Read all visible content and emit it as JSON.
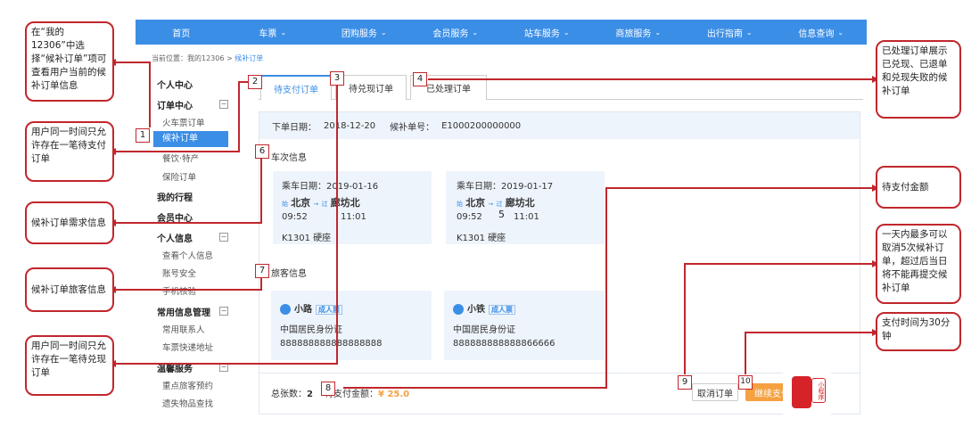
{
  "nav": [
    "首页",
    "车票",
    "团购服务",
    "会员服务",
    "站车服务",
    "商旅服务",
    "出行指南",
    "信息查询"
  ],
  "breadcrumb": {
    "prefix": "当前位置：",
    "path": "我的12306 > ",
    "current": "候补订单"
  },
  "sidebar": {
    "personal_center": "个人中心",
    "order_center": "订单中心",
    "ticket_order": "火车票订单",
    "waitlist_order": "候补订单",
    "food": "餐饮·特产",
    "insurance": "保险订单",
    "my_trips": "我的行程",
    "member_center": "会员中心",
    "personal_info": "个人信息",
    "view_info": "查看个人信息",
    "account_security": "账号安全",
    "phone_verify": "手机核验",
    "common_info": "常用信息管理",
    "contacts": "常用联系人",
    "address": "车票快递地址",
    "warm_service": "温馨服务",
    "vip_booking": "重点旅客预约",
    "lost_found": "遗失物品查找",
    "toggle": "−"
  },
  "tabs": [
    "待支付订单",
    "待兑现订单",
    "已处理订单"
  ],
  "order": {
    "date_label": "下单日期：",
    "date": "2018-12-20",
    "no_label": "候补单号：",
    "no": "E1000200000000",
    "train_section": "车次信息",
    "passenger_section": "旅客信息",
    "trips": [
      {
        "date_label": "乘车日期：",
        "date": "2019-01-16",
        "from_tag": "始",
        "from": "北京",
        "via": "过",
        "to": "廊坊北",
        "dep": "09:52",
        "arr": "11:01",
        "train": "K1301 硬座"
      },
      {
        "date_label": "乘车日期：",
        "date": "2019-01-17",
        "from_tag": "始",
        "from": "北京",
        "via": "过",
        "to": "廊坊北",
        "dep": "09:52",
        "arr": "11:01",
        "train": "K1301 硬座"
      }
    ],
    "passengers": [
      {
        "name": "小路",
        "type": "成人票",
        "id_type": "中国居民身份证",
        "id": "888888888888888888"
      },
      {
        "name": "小铁",
        "type": "成人票",
        "id_type": "中国居民身份证",
        "id": "888888888888866666"
      }
    ],
    "total_label": "总张数：",
    "total": "2",
    "amount_label": "待支付金额：",
    "amount": "¥ 25.0",
    "cancel": "取消订单",
    "pay": "继续支付"
  },
  "callouts": {
    "c_left1": "在“我的12306”中选择“候补订单”项可查看用户当前的候补订单信息",
    "c_left2": "用户同一时间只允许存在一笔待支付订单",
    "c_left3": "候补订单需求信息",
    "c_left4": "候补订单旅客信息",
    "c_left5": "用户同一时间只允许存在一笔待兑现订单",
    "c_right1": "已处理订单展示已兑现、已退单和兑现失败的候补订单",
    "c_right2": "待支付金额",
    "c_right3": "一天内最多可以取消5次候补订单，超过后当日将不能再提交候补订单",
    "c_right4": "支付时间为30分钟"
  },
  "numbers": [
    "1",
    "2",
    "3",
    "4",
    "5",
    "6",
    "7",
    "8",
    "9",
    "10"
  ],
  "logo": "小程序",
  "colors": {
    "accent": "#3b8ee6",
    "callout": "#c0272d",
    "pay": "#f5a041"
  }
}
